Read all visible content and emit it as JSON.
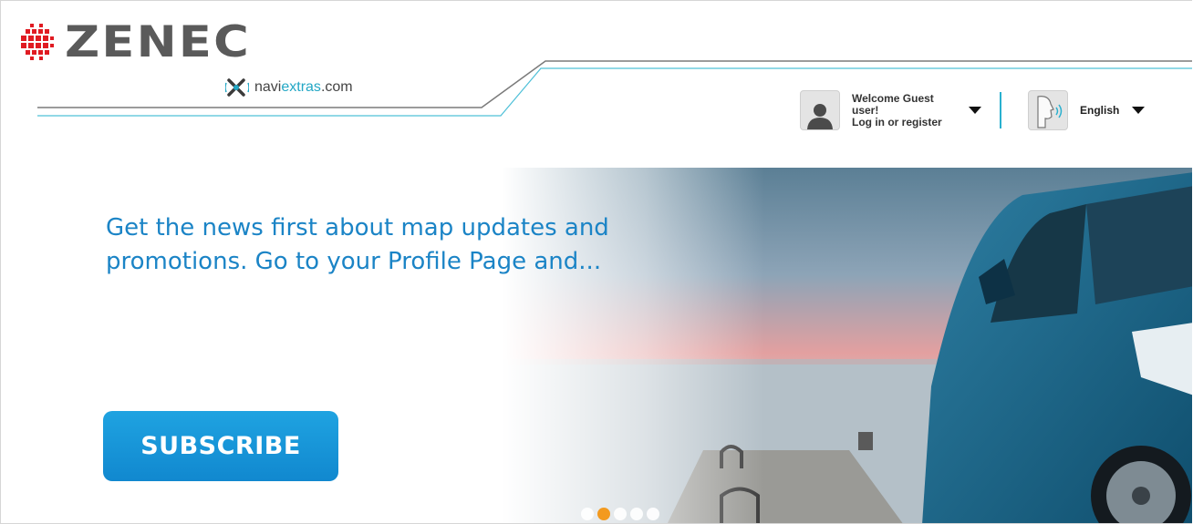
{
  "header": {
    "brand_name": "ZENEC",
    "partner": {
      "prefix": "navi",
      "accent": "extras",
      "suffix": ".com"
    },
    "user": {
      "greeting": "Welcome Guest user!",
      "action": "Log in or register",
      "icon": "user-icon"
    },
    "language": {
      "label": "English",
      "icon": "speaking-head-icon"
    }
  },
  "hero": {
    "headline": "Get the news first about map updates and promotions. Go to your Profile Page and...",
    "button_label": "SUBSCRIBE",
    "slides": {
      "count": 5,
      "active_index": 1
    }
  },
  "colors": {
    "brand_red": "#e01b22",
    "accent_blue": "#1b84c6",
    "button_blue": "#1a98db",
    "line_teal": "#29b0cf",
    "active_dot": "#f39a1f"
  }
}
